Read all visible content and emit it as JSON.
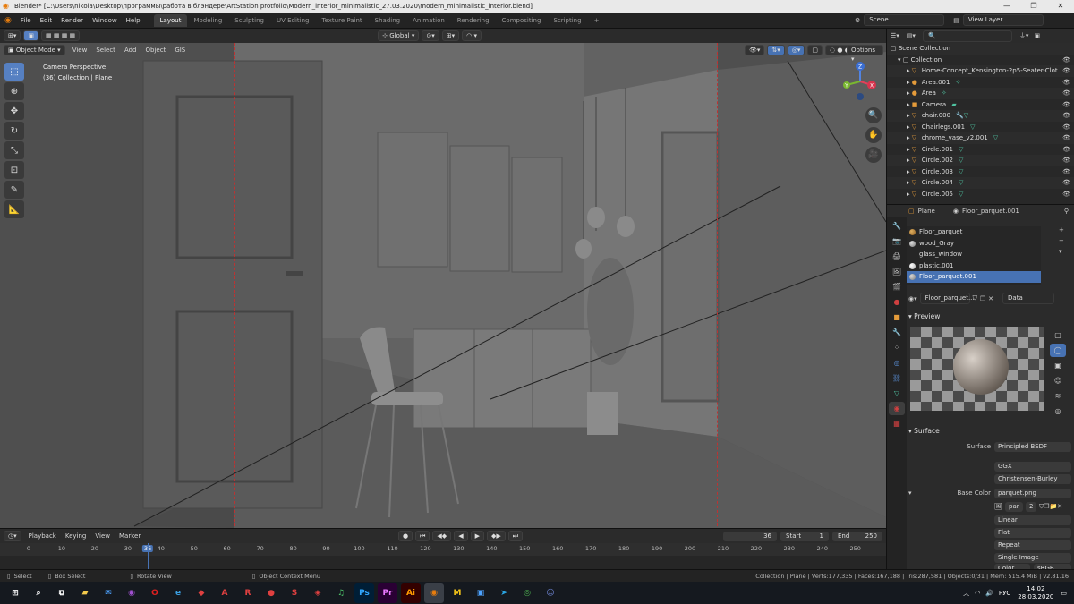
{
  "window": {
    "title": "Blender* [C:\\Users\\nikola\\Desktop\\программы\\работа в блэндере\\ArtStation protfolio\\Modern_interior_minimalistic_27.03.2020\\modern_minimalistic_interior.blend]"
  },
  "menu": [
    "File",
    "Edit",
    "Render",
    "Window",
    "Help"
  ],
  "workspaces": [
    "Layout",
    "Modeling",
    "Sculpting",
    "UV Editing",
    "Texture Paint",
    "Shading",
    "Animation",
    "Rendering",
    "Compositing",
    "Scripting"
  ],
  "active_workspace": "Layout",
  "scene": {
    "scene_name": "Scene",
    "view_layer": "View Layer"
  },
  "tool_header": {
    "orientation": "Global"
  },
  "viewport_header": {
    "mode": "Object Mode",
    "items": [
      "View",
      "Select",
      "Add",
      "Object",
      "GIS"
    ],
    "options_label": "Options"
  },
  "viewport_info": {
    "line1": "Camera Perspective",
    "line2": "(36) Collection | Plane"
  },
  "gizmo": {
    "x": "X",
    "y": "Y",
    "z": "Z"
  },
  "outliner": {
    "root": "Scene Collection",
    "collection": "Collection",
    "objects": [
      "Home-Concept_Kensington-2p5-Seater-Clot",
      "Area.001",
      "Area",
      "Camera",
      "chair.000",
      "Chairlegs.001",
      "chrome_vase_v2.001",
      "Circle.001",
      "Circle.002",
      "Circle.003",
      "Circle.004",
      "Circle.005"
    ]
  },
  "properties": {
    "object": "Plane",
    "material": "Floor_parquet.001",
    "slots": [
      "Floor_parquet",
      "wood_Gray",
      "glass_window",
      "plastic.001",
      "Floor_parquet.001"
    ],
    "selected_slot": "Floor_parquet.001",
    "material_field": "Floor_parquet...",
    "link": "Data",
    "preview_label": "Preview",
    "surface_label": "Surface",
    "surface_field_label": "Surface",
    "surface_value": "Principled BSDF",
    "distribution": "GGX",
    "subsurface_method": "Christensen-Burley",
    "base_color_label": "Base Color",
    "base_color_value": "parquet.png",
    "image_short": "par",
    "image_users": "2",
    "interpolation": "Linear",
    "projection": "Flat",
    "extension": "Repeat",
    "source": "Single Image",
    "color_space_label": "Color Spac",
    "color_space_value": "sRGB"
  },
  "timeline": {
    "menus": [
      "Playback",
      "Keying",
      "View",
      "Marker"
    ],
    "current_frame": "36",
    "start_label": "Start",
    "start": "1",
    "end_label": "End",
    "end": "250",
    "ticks": [
      "0",
      "10",
      "20",
      "30",
      "36",
      "40",
      "50",
      "60",
      "70",
      "80",
      "90",
      "100",
      "110",
      "120",
      "130",
      "140",
      "150",
      "160",
      "170",
      "180",
      "190",
      "200",
      "210",
      "220",
      "230",
      "240",
      "250"
    ]
  },
  "statusbar": {
    "select": "Select",
    "box_select": "Box Select",
    "rotate_view": "Rotate View",
    "context_menu": "Object Context Menu",
    "stats": "Collection | Plane | Verts:177,335 | Faces:167,188 | Tris:287,581 | Objects:0/31 | Mem: 515.4 MiB | v2.81.16"
  },
  "taskbar": {
    "language": "РУС",
    "time": "14:02",
    "date": "28.03.2020"
  }
}
